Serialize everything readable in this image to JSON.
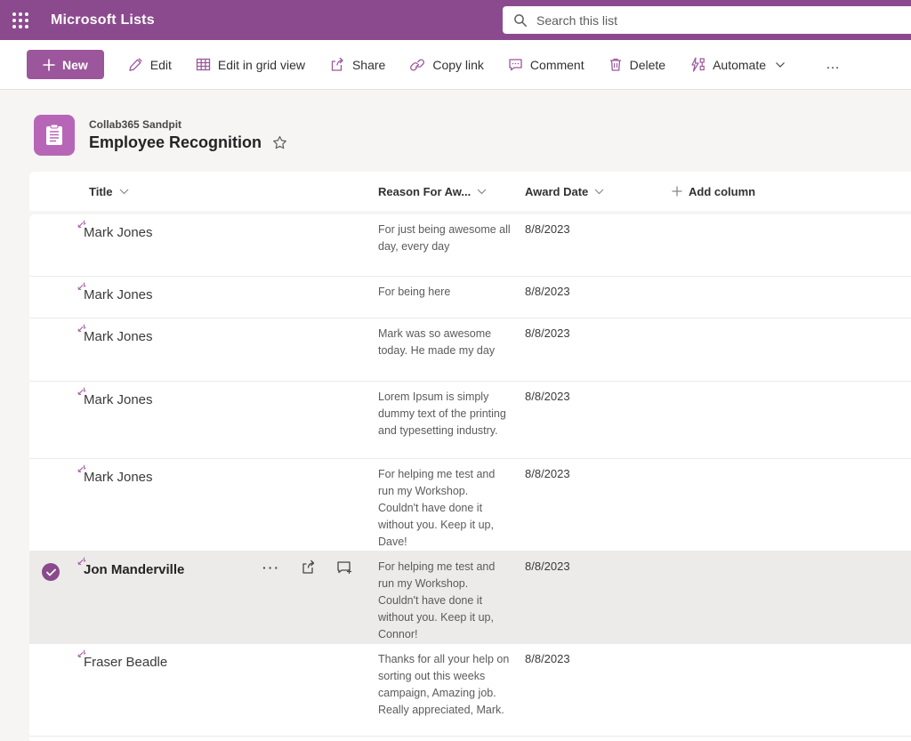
{
  "topbar": {
    "app_title": "Microsoft Lists",
    "search_placeholder": "Search this list"
  },
  "toolbar": {
    "new_label": "New",
    "edit_label": "Edit",
    "grid_view_label": "Edit in grid view",
    "share_label": "Share",
    "copy_link_label": "Copy link",
    "comment_label": "Comment",
    "delete_label": "Delete",
    "automate_label": "Automate",
    "overflow_label": "…"
  },
  "list_header": {
    "site_name": "Collab365 Sandpit",
    "list_title": "Employee Recognition"
  },
  "table": {
    "columns": {
      "title": "Title",
      "reason": "Reason For Aw...",
      "date": "Award Date"
    },
    "add_column_label": "Add column",
    "rows": [
      {
        "title": "Mark Jones",
        "reason": "For just being awesome all day, every day",
        "date": "8/8/2023",
        "selected": false
      },
      {
        "title": "Mark Jones",
        "reason": "For being here",
        "date": "8/8/2023",
        "selected": false
      },
      {
        "title": "Mark Jones",
        "reason": "Mark was so awesome today. He made my day",
        "date": "8/8/2023",
        "selected": false
      },
      {
        "title": "Mark Jones",
        "reason": "Lorem Ipsum is simply dummy text of the printing and typesetting industry.",
        "date": "8/8/2023",
        "selected": false
      },
      {
        "title": "Mark Jones",
        "reason": "For helping me test and run my Workshop. Couldn't have done it without you. Keep it up, Dave!",
        "date": "8/8/2023",
        "selected": false
      },
      {
        "title": "Jon Manderville",
        "reason": "For helping me test and run my Workshop. Couldn't have done it without you. Keep it up, Connor!",
        "date": "8/8/2023",
        "selected": true
      },
      {
        "title": "Fraser Beadle",
        "reason": "Thanks for all your help on sorting out this weeks campaign, Amazing job. Really appreciated, Mark.",
        "date": "8/8/2023",
        "selected": false
      }
    ]
  },
  "colors": {
    "brand_purple": "#8C4A8E",
    "button_purple": "#9C569C",
    "list_icon_purple": "#B766B7",
    "selected_row": "#EDEBE9"
  }
}
